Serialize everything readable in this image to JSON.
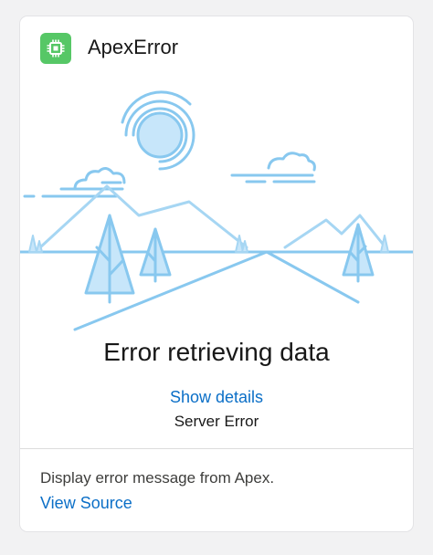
{
  "card": {
    "title": "ApexError",
    "icon": "chip-icon",
    "icon_color": "#56c766"
  },
  "error": {
    "title": "Error retrieving data",
    "details_link": "Show details",
    "message": "Server Error"
  },
  "footer": {
    "description": "Display error message from Apex.",
    "link": "View Source"
  },
  "colors": {
    "illustration_line": "#88c8ef",
    "illustration_fill": "#c7e6fa",
    "link": "#0b6fc7"
  }
}
